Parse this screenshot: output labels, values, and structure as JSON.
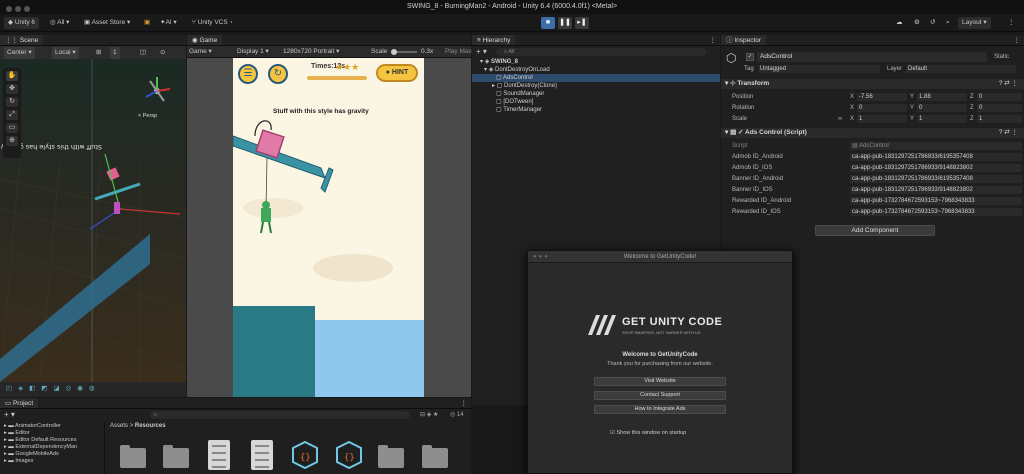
{
  "window": {
    "title": "SWING_8 - BurningMan2 - Android - Unity 6.4 (6000.4.0f1) <Metal>"
  },
  "toolbar": {
    "account": "Unity 6",
    "ai_pre": "All",
    "asset_store": "Asset Store",
    "ai": "AI",
    "vcs": "Unity VCS",
    "layout": "Layout"
  },
  "scene": {
    "tab": "Scene",
    "center": "Center",
    "local": "Local",
    "persp": "< Persp",
    "canvas_text": "Stuff with this style has gravity"
  },
  "game": {
    "tab": "Game",
    "mode": "Game",
    "display": "Display 1",
    "resolution": "1280x720 Portrait",
    "scale_label": "Scale",
    "scale_value": "0.3x",
    "play_max": "Play Maxim",
    "times": "Times:12s",
    "hint": "HINT",
    "hint_text": "Stuff with this style has gravity"
  },
  "hierarchy": {
    "tab": "Hierarchy",
    "search": "All",
    "items": [
      "SWING_8",
      "DontDestroyOnLoad",
      "AdsControl",
      "DontDestroy(Clone)",
      "SoundManager",
      "[DOTween]",
      "TimerManager"
    ]
  },
  "inspector": {
    "tab": "Inspector",
    "object_name": "AdsControl",
    "static": "Static",
    "tag_label": "Tag",
    "tag": "Untagged",
    "layer_label": "Layer",
    "layer": "Default",
    "transform": "Transform",
    "position_label": "Position",
    "rotation_label": "Rotation",
    "scale_label": "Scale",
    "pos": {
      "x": "-7.56",
      "y": "1.88",
      "z": "0"
    },
    "rot": {
      "x": "0",
      "y": "0",
      "z": "0"
    },
    "scale": {
      "x": "1",
      "y": "1",
      "z": "1"
    },
    "script_comp": "Ads Control (Script)",
    "script_label": "Script",
    "script_value": "AdsControl",
    "fields": [
      {
        "label": "Admob ID_Android",
        "value": "ca-app-pub-1831297251786933/6195357408"
      },
      {
        "label": "Admob ID_IOS",
        "value": "ca-app-pub-1831297251786933/9148823802"
      },
      {
        "label": "Banner ID_Android",
        "value": "ca-app-pub-1831297251786933/6195357408"
      },
      {
        "label": "Banner ID_IOS",
        "value": "ca-app-pub-1831297251786933/9148823802"
      },
      {
        "label": "Rewarded ID_Android",
        "value": "ca-app-pub-1732784672593153~7968343833"
      },
      {
        "label": "Rewarded ID_IOS",
        "value": "ca-app-pub-1732784672593153~7968343833"
      }
    ],
    "add_component": "Add Component"
  },
  "project": {
    "tab": "Project",
    "breadcrumb_root": "Assets",
    "breadcrumb_sep": ">",
    "breadcrumb_leaf": "Resources",
    "count": "14",
    "tree": [
      "AnimatorController",
      "Editor",
      "Editor Default Resources",
      "ExternalDependencyMan",
      "GoogleMobileAds",
      "Images"
    ]
  },
  "welcome": {
    "title": "Welcome to GetUnityCode!",
    "brand": "GET UNITY CODE",
    "tagline": "SHOP SMARTER, NOT HARDER WITH US.",
    "heading": "Welcome to GetUnityCode",
    "subtitle": "Thank you for purchasing from our website.",
    "btn1": "Visit Website",
    "btn2": "Contact Support",
    "btn3": "How to Integrate Ads",
    "show": "Show this window on startup"
  }
}
